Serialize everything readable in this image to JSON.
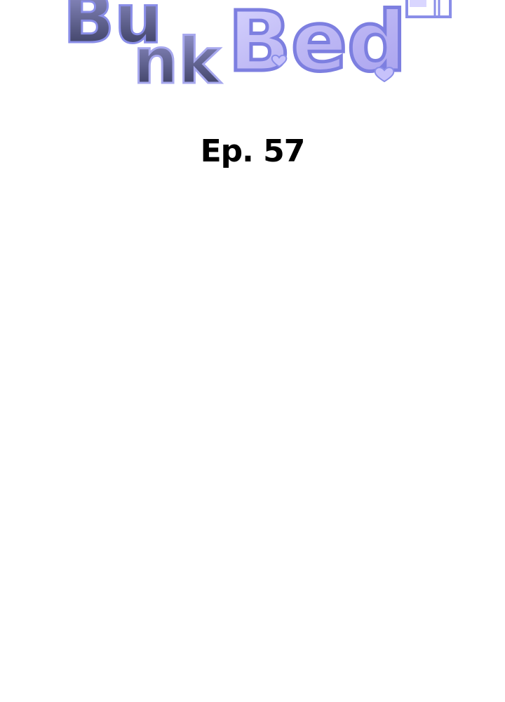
{
  "logo": {
    "text_part1": "Bu",
    "text_part2": "nk",
    "text_part3": "Bed"
  },
  "episode": {
    "label": "Ep. 57"
  },
  "colors": {
    "logo_dark": "#3b3f63",
    "logo_light": "#b9b8f5",
    "logo_outline": "#8a8ee8",
    "text": "#000000",
    "background": "#ffffff"
  }
}
